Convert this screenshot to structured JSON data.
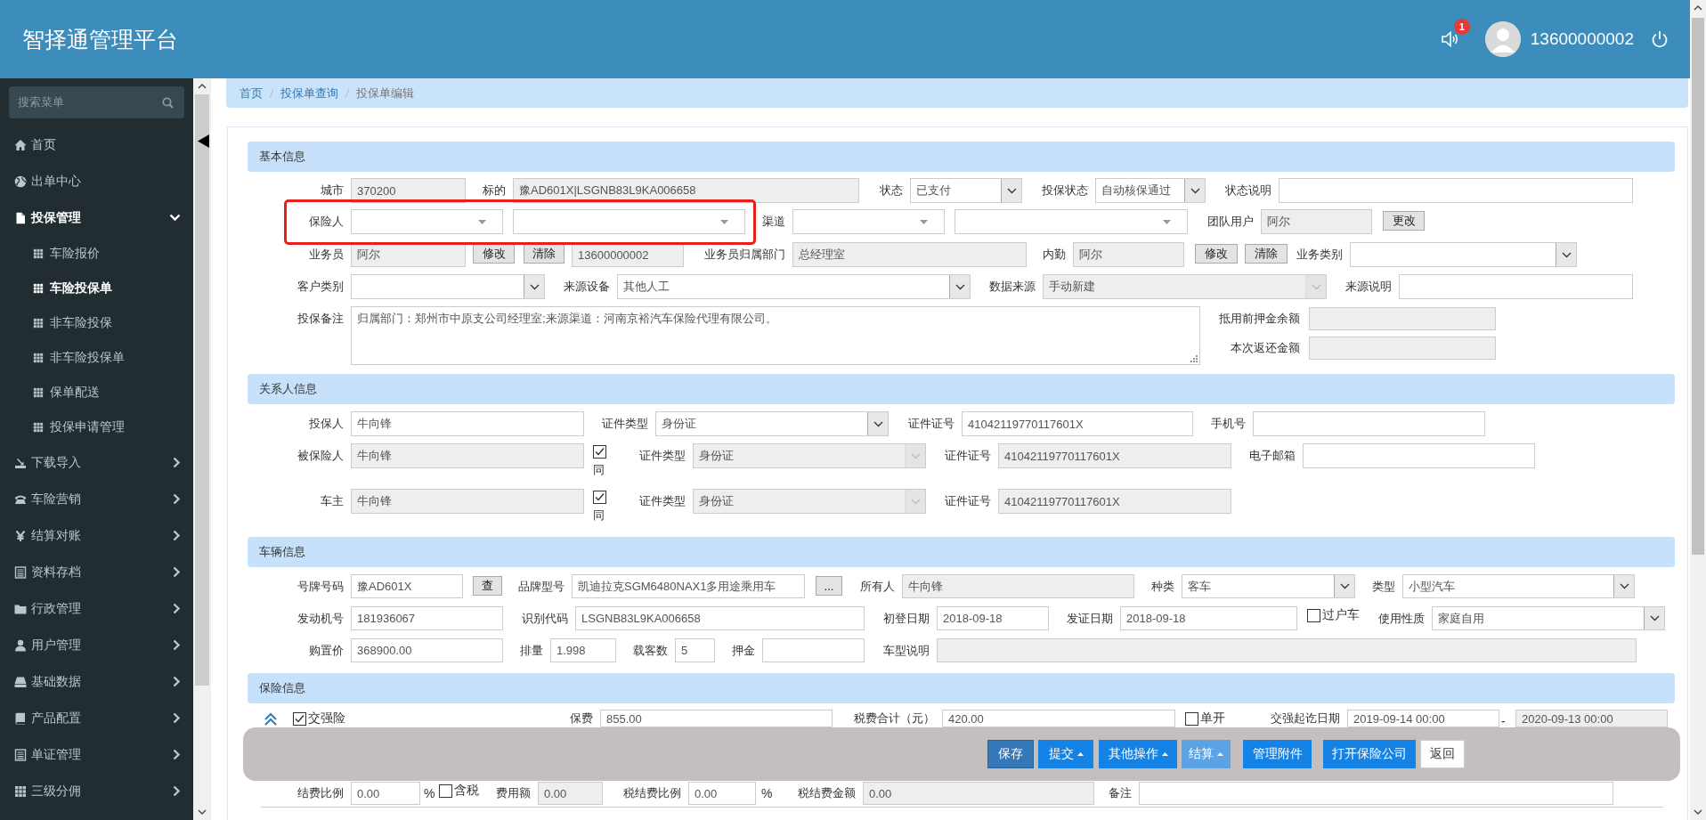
{
  "header": {
    "title": "智择通管理平台",
    "notification_count": "1",
    "user": "13600000002"
  },
  "sidebar": {
    "search": {
      "placeholder": "搜索菜单"
    },
    "items": [
      {
        "label": "首页"
      },
      {
        "label": "出单中心"
      },
      {
        "label": "投保管理",
        "expanded": true,
        "children": [
          {
            "label": "车险报价",
            "selected": false
          },
          {
            "label": "车险投保单",
            "selected": true
          },
          {
            "label": "非车险投保",
            "selected": false
          },
          {
            "label": "非车险投保单",
            "selected": false
          },
          {
            "label": "保单配送",
            "selected": false
          },
          {
            "label": "投保申请管理",
            "selected": false
          }
        ]
      },
      {
        "label": "下载导入",
        "expanded": false
      },
      {
        "label": "车险营销",
        "expanded": false
      },
      {
        "label": "结算对账",
        "expanded": false
      },
      {
        "label": "资料存档",
        "expanded": false
      },
      {
        "label": "行政管理",
        "expanded": false
      },
      {
        "label": "用户管理",
        "expanded": false
      },
      {
        "label": "基础数据",
        "expanded": false
      },
      {
        "label": "产品配置",
        "expanded": false
      },
      {
        "label": "单证管理",
        "expanded": false
      },
      {
        "label": "三级分佣",
        "expanded": false
      }
    ]
  },
  "breadcrumb": [
    "首页",
    "投保单查询",
    "投保单编辑"
  ],
  "sections": [
    {
      "title": "基本信息",
      "rows": [
        {
          "items": [
            {
              "kind": "label",
              "text": "城市"
            },
            {
              "kind": "input",
              "value": "370200",
              "disabled": true
            },
            {
              "kind": "label",
              "text": "标的"
            },
            {
              "kind": "input",
              "value": "豫AD601X|LSGNB83L9KA006658",
              "disabled": true
            },
            {
              "kind": "label",
              "text": "状态"
            },
            {
              "kind": "select",
              "value": "已支付",
              "disabled": false
            },
            {
              "kind": "label",
              "text": "投保状态"
            },
            {
              "kind": "select",
              "value": "自动核保通过",
              "disabled": false
            },
            {
              "kind": "label",
              "text": "状态说明"
            },
            {
              "kind": "input",
              "disabled": false
            }
          ]
        },
        {
          "items": [
            {
              "kind": "label",
              "text": "保险人"
            },
            {
              "kind": "combo",
              "disabled": false
            },
            {
              "kind": "combo",
              "disabled": false
            },
            {
              "kind": "label",
              "text": "渠道"
            },
            {
              "kind": "combo",
              "disabled": false
            },
            {
              "kind": "combo",
              "disabled": false
            },
            {
              "kind": "label",
              "text": "团队用户"
            },
            {
              "kind": "input",
              "value": "阿尔",
              "disabled": true
            },
            {
              "kind": "button",
              "label": "更改"
            }
          ]
        },
        {
          "items": [
            {
              "kind": "label",
              "text": "业务员"
            },
            {
              "kind": "input",
              "value": "阿尔",
              "disabled": true
            },
            {
              "kind": "button",
              "label": "修改"
            },
            {
              "kind": "button",
              "label": "清除"
            },
            {
              "kind": "input",
              "value": "13600000002",
              "disabled": true
            },
            {
              "kind": "label",
              "text": "业务员归属部门"
            },
            {
              "kind": "input",
              "value": "总经理室",
              "disabled": true
            },
            {
              "kind": "label",
              "text": "内勤"
            },
            {
              "kind": "input",
              "value": "阿尔",
              "disabled": true
            },
            {
              "kind": "button",
              "label": "修改"
            },
            {
              "kind": "button",
              "label": "清除"
            },
            {
              "kind": "label",
              "text": "业务类别"
            },
            {
              "kind": "select",
              "disabled": false
            }
          ]
        },
        {
          "items": [
            {
              "kind": "label",
              "text": "客户类别"
            },
            {
              "kind": "select",
              "disabled": false
            },
            {
              "kind": "label",
              "text": "来源设备"
            },
            {
              "kind": "select",
              "value": "其他人工",
              "disabled": false
            },
            {
              "kind": "label",
              "text": "数据来源"
            },
            {
              "kind": "select",
              "value": "手动新建",
              "disabled": true
            },
            {
              "kind": "label",
              "text": "来源说明"
            },
            {
              "kind": "input",
              "disabled": false
            }
          ]
        },
        {
          "items": [
            {
              "kind": "label",
              "text": "投保备注"
            },
            {
              "kind": "textarea",
              "value": "归属部门：郑州市中原支公司经理室;来源渠道：河南京裕汽车保险代理有限公司。",
              "disabled": false
            },
            {
              "kind": "stack",
              "fields": [
                {
                  "label": "抵用前押金余额",
                  "disabled": true
                },
                {
                  "label": "本次返还金额",
                  "disabled": true
                }
              ]
            }
          ]
        }
      ]
    },
    {
      "title": "关系人信息",
      "rows": [
        {
          "items": [
            {
              "kind": "label",
              "text": "投保人"
            },
            {
              "kind": "input",
              "value": "牛向锋",
              "disabled": false
            },
            {
              "kind": "label",
              "text": "证件类型"
            },
            {
              "kind": "select",
              "value": "身份证",
              "disabled": false
            },
            {
              "kind": "label",
              "text": "证件证号"
            },
            {
              "kind": "input",
              "value": "41042119770117601X",
              "disabled": false
            },
            {
              "kind": "label",
              "text": "手机号"
            },
            {
              "kind": "input",
              "disabled": false
            }
          ]
        },
        {
          "items": [
            {
              "kind": "label",
              "text": "被保险人"
            },
            {
              "kind": "input",
              "value": "牛向锋",
              "disabled": true
            },
            {
              "kind": "checkbox-stacked",
              "label": "同",
              "checked": true
            },
            {
              "kind": "label",
              "text": "证件类型"
            },
            {
              "kind": "select",
              "value": "身份证",
              "disabled": true
            },
            {
              "kind": "label",
              "text": "证件证号"
            },
            {
              "kind": "input",
              "value": "41042119770117601X",
              "disabled": true
            },
            {
              "kind": "label",
              "text": "电子邮箱"
            },
            {
              "kind": "input",
              "disabled": false
            }
          ]
        },
        {
          "items": [
            {
              "kind": "label",
              "text": "车主"
            },
            {
              "kind": "input",
              "value": "牛向锋",
              "disabled": true
            },
            {
              "kind": "checkbox-stacked",
              "label": "同",
              "checked": true
            },
            {
              "kind": "label",
              "text": "证件类型"
            },
            {
              "kind": "select",
              "value": "身份证",
              "disabled": true
            },
            {
              "kind": "label",
              "text": "证件证号"
            },
            {
              "kind": "input",
              "value": "41042119770117601X",
              "disabled": true
            }
          ]
        }
      ]
    },
    {
      "title": "车辆信息",
      "rows": [
        {
          "items": [
            {
              "kind": "label",
              "text": "号牌号码"
            },
            {
              "kind": "input",
              "value": "豫AD601X",
              "disabled": false
            },
            {
              "kind": "button",
              "label": "查"
            },
            {
              "kind": "label",
              "text": "品牌型号"
            },
            {
              "kind": "input",
              "value": "凯迪拉克SGM6480NAX1多用途乘用车",
              "disabled": false
            },
            {
              "kind": "button",
              "label": "..."
            },
            {
              "kind": "label",
              "text": "所有人"
            },
            {
              "kind": "input",
              "value": "牛向锋",
              "disabled": true
            },
            {
              "kind": "label",
              "text": "种类"
            },
            {
              "kind": "select",
              "value": "客车",
              "disabled": false
            },
            {
              "kind": "label",
              "text": "类型"
            },
            {
              "kind": "select",
              "value": "小型汽车",
              "disabled": false
            }
          ]
        },
        {
          "items": [
            {
              "kind": "label",
              "text": "发动机号"
            },
            {
              "kind": "input",
              "value": "181936067",
              "disabled": false
            },
            {
              "kind": "label",
              "text": "识别代码"
            },
            {
              "kind": "input",
              "value": "LSGNB83L9KA006658",
              "disabled": false
            },
            {
              "kind": "label",
              "text": "初登日期"
            },
            {
              "kind": "input",
              "value": "2018-09-18",
              "disabled": false
            },
            {
              "kind": "label",
              "text": "发证日期"
            },
            {
              "kind": "input",
              "value": "2018-09-18",
              "disabled": false
            },
            {
              "kind": "checkbox",
              "label": "过户车",
              "checked": false
            },
            {
              "kind": "label",
              "text": "使用性质"
            },
            {
              "kind": "select",
              "value": "家庭自用",
              "disabled": false
            }
          ]
        },
        {
          "items": [
            {
              "kind": "label",
              "text": "购置价"
            },
            {
              "kind": "input",
              "value": "368900.00",
              "disabled": false
            },
            {
              "kind": "label",
              "text": "排量"
            },
            {
              "kind": "input",
              "value": "1.998",
              "disabled": false
            },
            {
              "kind": "label",
              "text": "载客数"
            },
            {
              "kind": "input",
              "value": "5",
              "disabled": false
            },
            {
              "kind": "label",
              "text": "押金"
            },
            {
              "kind": "input",
              "disabled": false
            },
            {
              "kind": "label",
              "text": "车型说明"
            },
            {
              "kind": "input",
              "disabled": true
            }
          ]
        }
      ]
    },
    {
      "title": "保险信息",
      "rows": [
        {
          "items": [
            {
              "kind": "expander",
              "expanded": true
            },
            {
              "kind": "checkbox",
              "label": "交强险",
              "checked": true
            },
            {
              "kind": "label",
              "text": "保费"
            },
            {
              "kind": "input",
              "value": "855.00",
              "disabled": false
            },
            {
              "kind": "label",
              "text": "税费合计（元）"
            },
            {
              "kind": "input",
              "value": "420.00",
              "disabled": false
            },
            {
              "kind": "checkbox",
              "label": "单开",
              "checked": false
            },
            {
              "kind": "label",
              "text": "交强起讫日期"
            },
            {
              "kind": "input",
              "value": "2019-09-14 00:00",
              "disabled": false
            },
            {
              "kind": "text",
              "text": "-"
            },
            {
              "kind": "input",
              "value": "2020-09-13 00:00",
              "disabled": true
            }
          ]
        },
        {
          "items": [
            {
              "kind": "label",
              "text": "结费比例"
            },
            {
              "kind": "input",
              "value": "0.00",
              "disabled": false
            },
            {
              "kind": "text",
              "text": "%"
            },
            {
              "kind": "checkbox",
              "label": "含税",
              "checked": false
            },
            {
              "kind": "label",
              "text": "费用额"
            },
            {
              "kind": "input",
              "value": "0.00",
              "disabled": true
            },
            {
              "kind": "label",
              "text": "税结费比例"
            },
            {
              "kind": "input",
              "value": "0.00",
              "disabled": false
            },
            {
              "kind": "text",
              "text": "%"
            },
            {
              "kind": "label",
              "text": "税结费金额"
            },
            {
              "kind": "input",
              "value": "0.00",
              "disabled": true
            },
            {
              "kind": "label",
              "text": "备注"
            },
            {
              "kind": "input",
              "disabled": false
            }
          ]
        }
      ]
    }
  ],
  "actions": [
    {
      "label": "保存",
      "kind": "dark",
      "dropdown": false
    },
    {
      "label": "提交",
      "kind": "primary",
      "dropdown": true
    },
    {
      "label": "其他操作",
      "kind": "primary",
      "dropdown": true
    },
    {
      "label": "结算",
      "kind": "light",
      "dropdown": true
    },
    {
      "label": "管理附件",
      "kind": "primary",
      "dropdown": false
    },
    {
      "label": "打开保险公司",
      "kind": "primary",
      "dropdown": false
    },
    {
      "label": "返回",
      "kind": "plain",
      "dropdown": false
    }
  ]
}
